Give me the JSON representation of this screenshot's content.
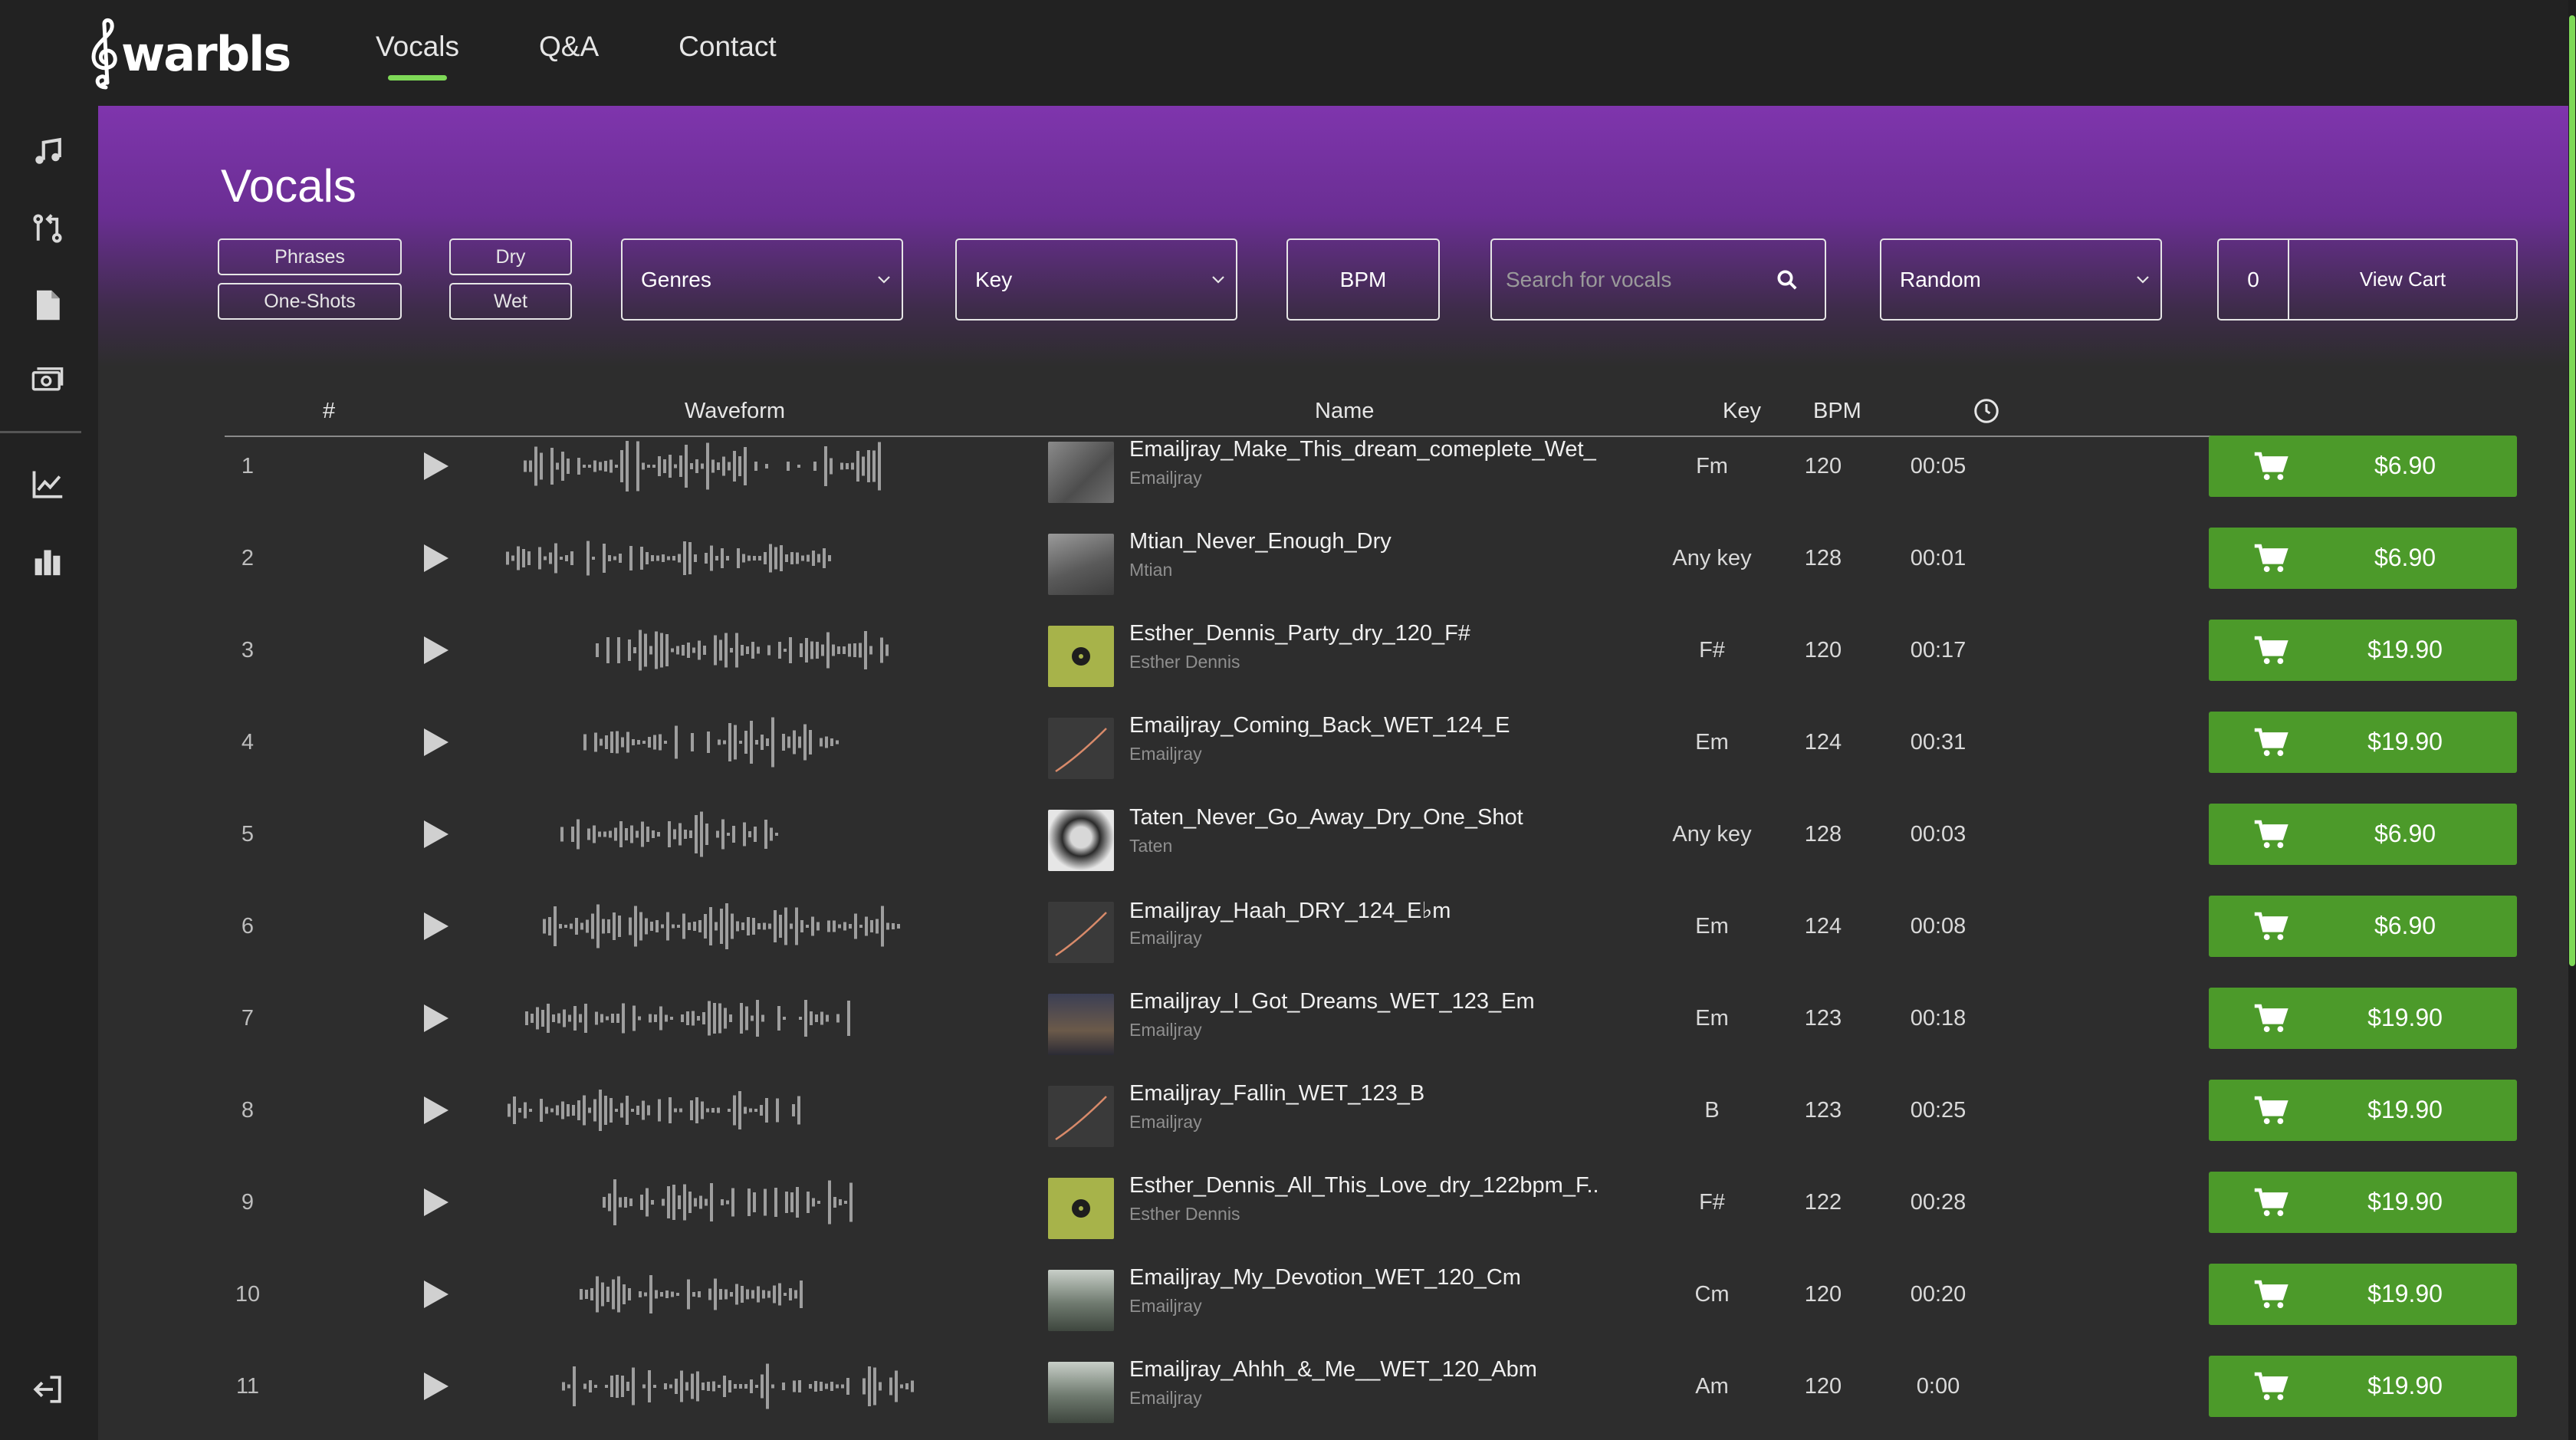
{
  "brand": {
    "name": "warbls"
  },
  "nav": [
    {
      "label": "Vocals",
      "active": true
    },
    {
      "label": "Q&A",
      "active": false
    },
    {
      "label": "Contact",
      "active": false
    }
  ],
  "sidebar": {
    "items": [
      {
        "icon": "music-note-icon"
      },
      {
        "icon": "git-compare-icon"
      },
      {
        "icon": "document-icon"
      },
      {
        "icon": "money-icon"
      },
      {
        "icon": "line-chart-icon"
      },
      {
        "icon": "bar-chart-icon"
      },
      {
        "icon": "logout-icon"
      }
    ]
  },
  "page": {
    "title": "Vocals"
  },
  "filters": {
    "type_phrases": "Phrases",
    "type_oneshots": "One-Shots",
    "dry": "Dry",
    "wet": "Wet",
    "genres": "Genres",
    "key": "Key",
    "bpm": "BPM",
    "search_placeholder": "Search for vocals",
    "sort": "Random",
    "cart_count": "0",
    "view_cart": "View  Cart"
  },
  "table": {
    "headers": {
      "index": "#",
      "waveform": "Waveform",
      "name": "Name",
      "key": "Key",
      "bpm": "BPM",
      "duration_icon": "clock-icon"
    },
    "rows": [
      {
        "index": "1",
        "title": "Emailjray_Make_This_dream_comeplete_Wet_",
        "artist": "Emailjray",
        "key": "Fm",
        "bpm": "120",
        "duration": "00:05",
        "price": "$6.90"
      },
      {
        "index": "2",
        "title": "Mtian_Never_Enough_Dry",
        "artist": "Mtian",
        "key": "Any key",
        "bpm": "128",
        "duration": "00:01",
        "price": "$6.90"
      },
      {
        "index": "3",
        "title": "Esther_Dennis_Party_dry_120_F#",
        "artist": "Esther Dennis",
        "key": "F#",
        "bpm": "120",
        "duration": "00:17",
        "price": "$19.90"
      },
      {
        "index": "4",
        "title": "Emailjray_Coming_Back_WET_124_E",
        "artist": "Emailjray",
        "key": "Em",
        "bpm": "124",
        "duration": "00:31",
        "price": "$19.90"
      },
      {
        "index": "5",
        "title": "Taten_Never_Go_Away_Dry_One_Shot",
        "artist": "Taten",
        "key": "Any key",
        "bpm": "128",
        "duration": "00:03",
        "price": "$6.90"
      },
      {
        "index": "6",
        "title": "Emailjray_Haah_DRY_124_E♭m",
        "artist": "Emailjray",
        "key": "Em",
        "bpm": "124",
        "duration": "00:08",
        "price": "$6.90"
      },
      {
        "index": "7",
        "title": "Emailjray_I_Got_Dreams_WET_123_Em",
        "artist": "Emailjray",
        "key": "Em",
        "bpm": "123",
        "duration": "00:18",
        "price": "$19.90"
      },
      {
        "index": "8",
        "title": "Emailjray_Fallin_WET_123_B",
        "artist": "Emailjray",
        "key": "B",
        "bpm": "123",
        "duration": "00:25",
        "price": "$19.90"
      },
      {
        "index": "9",
        "title": "Esther_Dennis_All_This_Love_dry_122bpm_F..",
        "artist": "Esther Dennis",
        "key": "F#",
        "bpm": "122",
        "duration": "00:28",
        "price": "$19.90"
      },
      {
        "index": "10",
        "title": "Emailjray_My_Devotion_WET_120_Cm",
        "artist": "Emailjray",
        "key": "Cm",
        "bpm": "120",
        "duration": "00:20",
        "price": "$19.90"
      },
      {
        "index": "11",
        "title": "Emailjray_Ahhh_&_Me__WET_120_Abm",
        "artist": "Emailjray",
        "key": "Am",
        "bpm": "120",
        "duration": "0:00",
        "price": "$19.90"
      }
    ]
  },
  "colors": {
    "accent": "#7ed957",
    "buy": "#4c9a2a",
    "hero_top": "#7f35ad",
    "bg": "#2d2d2d",
    "bar": "#222222"
  }
}
